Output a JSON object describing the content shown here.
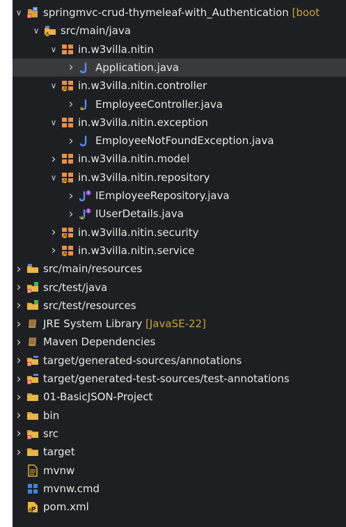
{
  "rows": [
    {
      "label": "springmvc-crud-thymeleaf-with_Authentication",
      "decoration": "[boot",
      "depth": 0,
      "expanded": true,
      "icon": "project-icon",
      "err": true
    },
    {
      "label": "src/main/java",
      "depth": 1,
      "expanded": true,
      "icon": "source-folder-icon",
      "warn": true
    },
    {
      "label": "in.w3villa.nitin",
      "depth": 2,
      "expanded": true,
      "icon": "package-icon"
    },
    {
      "label": "Application.java",
      "depth": 3,
      "expanded": false,
      "icon": "java-file-icon",
      "selected": true
    },
    {
      "label": "in.w3villa.nitin.controller",
      "depth": 2,
      "expanded": true,
      "icon": "package-icon",
      "warn": true
    },
    {
      "label": "EmployeeController.java",
      "depth": 3,
      "expanded": false,
      "icon": "java-file-icon",
      "warn": true
    },
    {
      "label": "in.w3villa.nitin.exception",
      "depth": 2,
      "expanded": true,
      "icon": "package-icon"
    },
    {
      "label": "EmployeeNotFoundException.java",
      "depth": 3,
      "expanded": false,
      "icon": "java-file-icon"
    },
    {
      "label": "in.w3villa.nitin.model",
      "depth": 2,
      "expanded": false,
      "icon": "package-icon"
    },
    {
      "label": "in.w3villa.nitin.repository",
      "depth": 2,
      "expanded": true,
      "icon": "package-icon",
      "warn": true
    },
    {
      "label": "IEmployeeRepository.java",
      "depth": 3,
      "expanded": false,
      "icon": "java-interface-icon"
    },
    {
      "label": "IUserDetails.java",
      "depth": 3,
      "expanded": false,
      "icon": "java-interface-icon",
      "warn": true
    },
    {
      "label": "in.w3villa.nitin.security",
      "depth": 2,
      "expanded": false,
      "icon": "package-icon",
      "warn": true
    },
    {
      "label": "in.w3villa.nitin.service",
      "depth": 2,
      "expanded": false,
      "icon": "package-icon",
      "warn": true
    },
    {
      "label": "src/main/resources",
      "depth": 0,
      "expanded": false,
      "icon": "source-folder-icon"
    },
    {
      "label": "src/test/java",
      "depth": 0,
      "expanded": false,
      "icon": "test-source-folder-icon",
      "err": true
    },
    {
      "label": "src/test/resources",
      "depth": 0,
      "expanded": false,
      "icon": "test-source-folder-icon"
    },
    {
      "label": "JRE System Library",
      "decoration": "[JavaSE-22]",
      "depth": 0,
      "expanded": false,
      "icon": "library-icon"
    },
    {
      "label": "Maven Dependencies",
      "depth": 0,
      "expanded": false,
      "icon": "library-icon"
    },
    {
      "label": "target/generated-sources/annotations",
      "depth": 0,
      "expanded": false,
      "icon": "generated-folder-icon",
      "err": true
    },
    {
      "label": "target/generated-test-sources/test-annotations",
      "depth": 0,
      "expanded": false,
      "icon": "generated-folder-icon",
      "err": true
    },
    {
      "label": "01-BasicJSON-Project",
      "depth": 0,
      "expanded": false,
      "icon": "folder-icon"
    },
    {
      "label": "bin",
      "depth": 0,
      "expanded": false,
      "icon": "folder-icon"
    },
    {
      "label": "src",
      "depth": 0,
      "expanded": false,
      "icon": "folder-icon",
      "err": true
    },
    {
      "label": "target",
      "depth": 0,
      "expanded": false,
      "icon": "folder-icon"
    },
    {
      "label": "mvnw",
      "depth": 0,
      "expanded": null,
      "icon": "text-file-icon"
    },
    {
      "label": "mvnw.cmd",
      "depth": 0,
      "expanded": null,
      "icon": "cmd-file-icon"
    },
    {
      "label": "pom.xml",
      "depth": 0,
      "expanded": null,
      "icon": "pom-file-icon",
      "warn": true
    }
  ]
}
